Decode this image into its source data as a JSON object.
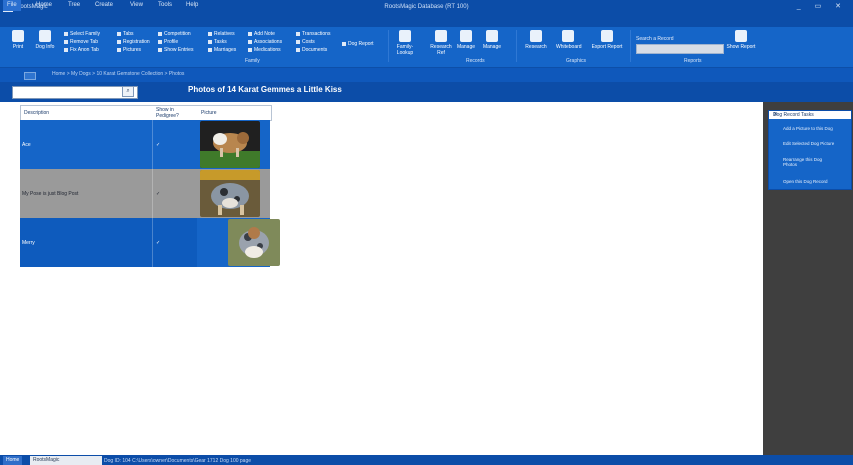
{
  "app": {
    "name": "RootsMagic",
    "window_title": "RootsMagic Database (RT 100)",
    "window_controls": "_ ▭ ✕"
  },
  "menu": [
    "File",
    "Home",
    "Tree",
    "Create",
    "View",
    "Tools",
    "Help"
  ],
  "ribbon": {
    "big_buttons": [
      "Print",
      "Dog Info",
      "Family-Lookup",
      "Research Ref",
      "Manage",
      "Manage",
      "Research",
      "Whiteboard",
      "Export Report",
      "Show Report"
    ],
    "column_a": [
      "Select Family",
      "Remove Tab",
      "Fix Anon Tab"
    ],
    "column_b": [
      "Tabs",
      "Registration",
      "Pictures"
    ],
    "column_c": [
      "Competition",
      "Profile",
      "Show Entries"
    ],
    "column_d": [
      "Relatives",
      "Tasks",
      "Marriages"
    ],
    "column_e": [
      "Add Note",
      "Associations",
      "Medications"
    ],
    "column_f": [
      "Transactions",
      "Costs",
      "Documents"
    ],
    "column_g": [
      "Dog Report"
    ],
    "groups": [
      "Family",
      "Records",
      "Graphics",
      "Reports"
    ],
    "search_label": "Search a Record"
  },
  "breadcrumb": "Home > My Dogs > 10 Karat Gemstone Collection > Photos",
  "search": {
    "placeholder": "",
    "button": "⌕"
  },
  "page_title": "Photos of 14 Karat Gemmes a Little Kiss",
  "grid": {
    "headers": [
      "Description",
      "Show in Pedigree?",
      "Picture"
    ],
    "rows": [
      {
        "description": "Ace",
        "show": "✓"
      },
      {
        "description": "My Pose is just Blog Post",
        "show": "✓"
      },
      {
        "description": "Merry",
        "show": "✓"
      }
    ]
  },
  "side_pane": {
    "title": "Dog Record Tasks",
    "close": "✕",
    "links": [
      "Add a Picture to this Dog",
      "Edit Selected Dog Picture",
      "Rearrange this Dog Photos",
      "Open this Dog Record"
    ]
  },
  "status": {
    "tab_active": "Home",
    "tab_other": "RootsMagic",
    "text": "Dog ID: 104   C:\\Users\\owner\\Documents\\Gear 1712 Dog 100 page"
  },
  "colors": {
    "chrome": "#0c4da8",
    "ribbon": "#1565c8",
    "row_blue": "#1565c8",
    "row_gray": "#9a9a9a",
    "row_dark": "#0e5bbd",
    "sidepane": "#3f3f3f"
  }
}
